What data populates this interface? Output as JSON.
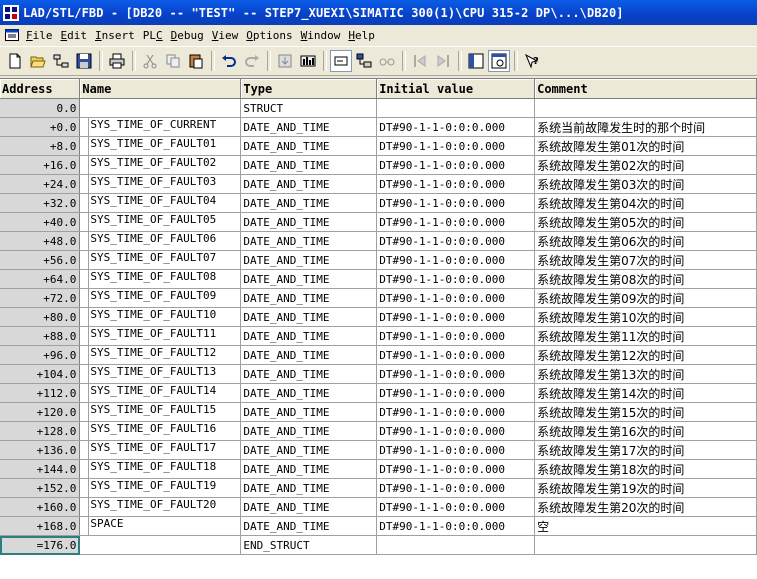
{
  "window": {
    "title": "LAD/STL/FBD  - [DB20 -- \"TEST\" -- STEP7_XUEXI\\SIMATIC 300(1)\\CPU 315-2 DP\\...\\DB20]"
  },
  "menu": {
    "items": [
      {
        "ul": "F",
        "rest": "ile"
      },
      {
        "ul": "E",
        "rest": "dit"
      },
      {
        "ul": "I",
        "rest": "nsert"
      },
      {
        "pre": "PL",
        "ul": "C",
        "rest": ""
      },
      {
        "ul": "D",
        "rest": "ebug"
      },
      {
        "ul": "V",
        "rest": "iew"
      },
      {
        "ul": "O",
        "rest": "ptions"
      },
      {
        "ul": "W",
        "rest": "indow"
      },
      {
        "ul": "H",
        "rest": "elp"
      }
    ]
  },
  "table": {
    "columns": [
      "Address",
      "Name",
      "Type",
      "Initial value",
      "Comment"
    ],
    "rows": [
      {
        "addr": "0.0",
        "name": "",
        "type": "STRUCT",
        "init": "",
        "comment": ""
      },
      {
        "addr": "+0.0",
        "name": "SYS_TIME_OF_CURRENT",
        "type": "DATE_AND_TIME",
        "init": "DT#90-1-1-0:0:0.000",
        "comment": "系统当前故障发生时的那个时间"
      },
      {
        "addr": "+8.0",
        "name": "SYS_TIME_OF_FAULT01",
        "type": "DATE_AND_TIME",
        "init": "DT#90-1-1-0:0:0.000",
        "comment": "系统故障发生第01次的时间"
      },
      {
        "addr": "+16.0",
        "name": "SYS_TIME_OF_FAULT02",
        "type": "DATE_AND_TIME",
        "init": "DT#90-1-1-0:0:0.000",
        "comment": "系统故障发生第02次的时间"
      },
      {
        "addr": "+24.0",
        "name": "SYS_TIME_OF_FAULT03",
        "type": "DATE_AND_TIME",
        "init": "DT#90-1-1-0:0:0.000",
        "comment": "系统故障发生第03次的时间"
      },
      {
        "addr": "+32.0",
        "name": "SYS_TIME_OF_FAULT04",
        "type": "DATE_AND_TIME",
        "init": "DT#90-1-1-0:0:0.000",
        "comment": "系统故障发生第04次的时间"
      },
      {
        "addr": "+40.0",
        "name": "SYS_TIME_OF_FAULT05",
        "type": "DATE_AND_TIME",
        "init": "DT#90-1-1-0:0:0.000",
        "comment": "系统故障发生第05次的时间"
      },
      {
        "addr": "+48.0",
        "name": "SYS_TIME_OF_FAULT06",
        "type": "DATE_AND_TIME",
        "init": "DT#90-1-1-0:0:0.000",
        "comment": "系统故障发生第06次的时间"
      },
      {
        "addr": "+56.0",
        "name": "SYS_TIME_OF_FAULT07",
        "type": "DATE_AND_TIME",
        "init": "DT#90-1-1-0:0:0.000",
        "comment": "系统故障发生第07次的时间"
      },
      {
        "addr": "+64.0",
        "name": "SYS_TIME_OF_FAULT08",
        "type": "DATE_AND_TIME",
        "init": "DT#90-1-1-0:0:0.000",
        "comment": "系统故障发生第08次的时间"
      },
      {
        "addr": "+72.0",
        "name": "SYS_TIME_OF_FAULT09",
        "type": "DATE_AND_TIME",
        "init": "DT#90-1-1-0:0:0.000",
        "comment": "系统故障发生第09次的时间"
      },
      {
        "addr": "+80.0",
        "name": "SYS_TIME_OF_FAULT10",
        "type": "DATE_AND_TIME",
        "init": "DT#90-1-1-0:0:0.000",
        "comment": "系统故障发生第10次的时间"
      },
      {
        "addr": "+88.0",
        "name": "SYS_TIME_OF_FAULT11",
        "type": "DATE_AND_TIME",
        "init": "DT#90-1-1-0:0:0.000",
        "comment": "系统故障发生第11次的时间"
      },
      {
        "addr": "+96.0",
        "name": "SYS_TIME_OF_FAULT12",
        "type": "DATE_AND_TIME",
        "init": "DT#90-1-1-0:0:0.000",
        "comment": "系统故障发生第12次的时间"
      },
      {
        "addr": "+104.0",
        "name": "SYS_TIME_OF_FAULT13",
        "type": "DATE_AND_TIME",
        "init": "DT#90-1-1-0:0:0.000",
        "comment": "系统故障发生第13次的时间"
      },
      {
        "addr": "+112.0",
        "name": "SYS_TIME_OF_FAULT14",
        "type": "DATE_AND_TIME",
        "init": "DT#90-1-1-0:0:0.000",
        "comment": "系统故障发生第14次的时间"
      },
      {
        "addr": "+120.0",
        "name": "SYS_TIME_OF_FAULT15",
        "type": "DATE_AND_TIME",
        "init": "DT#90-1-1-0:0:0.000",
        "comment": "系统故障发生第15次的时间"
      },
      {
        "addr": "+128.0",
        "name": "SYS_TIME_OF_FAULT16",
        "type": "DATE_AND_TIME",
        "init": "DT#90-1-1-0:0:0.000",
        "comment": "系统故障发生第16次的时间"
      },
      {
        "addr": "+136.0",
        "name": "SYS_TIME_OF_FAULT17",
        "type": "DATE_AND_TIME",
        "init": "DT#90-1-1-0:0:0.000",
        "comment": "系统故障发生第17次的时间"
      },
      {
        "addr": "+144.0",
        "name": "SYS_TIME_OF_FAULT18",
        "type": "DATE_AND_TIME",
        "init": "DT#90-1-1-0:0:0.000",
        "comment": "系统故障发生第18次的时间"
      },
      {
        "addr": "+152.0",
        "name": "SYS_TIME_OF_FAULT19",
        "type": "DATE_AND_TIME",
        "init": "DT#90-1-1-0:0:0.000",
        "comment": "系统故障发生第19次的时间"
      },
      {
        "addr": "+160.0",
        "name": "SYS_TIME_OF_FAULT20",
        "type": "DATE_AND_TIME",
        "init": "DT#90-1-1-0:0:0.000",
        "comment": "系统故障发生第20次的时间"
      },
      {
        "addr": "+168.0",
        "name": "SPACE",
        "type": "DATE_AND_TIME",
        "init": "DT#90-1-1-0:0:0.000",
        "comment": "空"
      },
      {
        "addr": "=176.0",
        "name": "",
        "type": "END_STRUCT",
        "init": "",
        "comment": "",
        "selected": true
      }
    ]
  },
  "toolbar": {
    "buttons": [
      "new-icon",
      "open-icon",
      "accessible-nodes-icon",
      "save-icon",
      "print-icon",
      "cut-icon",
      "copy-icon",
      "paste-icon",
      "undo-icon",
      "redo-icon",
      "download-icon",
      "monitor-icon",
      "declaration-view-icon",
      "data-view-icon",
      "glasses-icon",
      "breakpoint-prev-icon",
      "breakpoint-next-icon",
      "overview-icon",
      "zoom-icon",
      "help-icon"
    ]
  },
  "colors": {
    "titlebar": "#0841c8",
    "chrome": "#ece9d8",
    "address_column": "#d8d8d8",
    "selection_outline": "#2c7f7f"
  }
}
